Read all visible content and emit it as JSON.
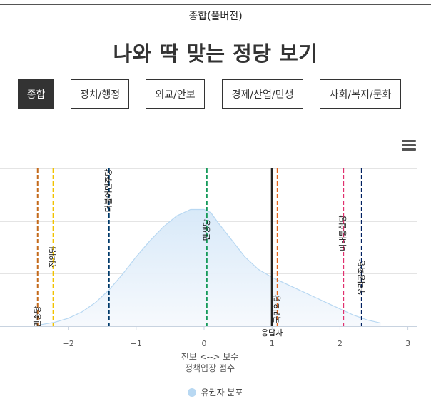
{
  "header": {
    "title": "종합(풀버전)"
  },
  "page": {
    "title": "나와 딱 맞는 정당 보기"
  },
  "tabs": [
    {
      "label": "종합",
      "active": true
    },
    {
      "label": "정치/행정",
      "active": false
    },
    {
      "label": "외교/안보",
      "active": false
    },
    {
      "label": "경제/산업/민생",
      "active": false
    },
    {
      "label": "사회/복지/문화",
      "active": false
    }
  ],
  "menu": {
    "icon": "hamburger-menu-icon"
  },
  "chart_data": {
    "type": "area",
    "xlabel": "진보 <--> 보수",
    "xlabel2": "정책입장 점수",
    "xlim": [
      -2.8,
      3.1
    ],
    "ylim": [
      0,
      1
    ],
    "grid": true,
    "xticks": [
      -2,
      -1,
      0,
      1,
      2,
      3
    ],
    "legend_position": "bottom",
    "series": [
      {
        "name": "유권자 분포",
        "color": "#b8d8f2",
        "x": [
          -2.4,
          -2.2,
          -2.0,
          -1.8,
          -1.6,
          -1.4,
          -1.2,
          -1.0,
          -0.8,
          -0.6,
          -0.4,
          -0.2,
          0.0,
          0.1,
          0.2,
          0.4,
          0.6,
          0.8,
          1.0,
          1.2,
          1.4,
          1.6,
          1.8,
          2.0,
          2.2,
          2.4,
          2.6
        ],
        "y": [
          0.01,
          0.025,
          0.05,
          0.09,
          0.15,
          0.23,
          0.33,
          0.44,
          0.54,
          0.63,
          0.7,
          0.74,
          0.74,
          0.72,
          0.66,
          0.55,
          0.44,
          0.36,
          0.31,
          0.27,
          0.23,
          0.19,
          0.15,
          0.11,
          0.07,
          0.04,
          0.02
        ]
      }
    ],
    "parties": [
      {
        "name": "민중당",
        "x": -2.45,
        "color": "#c46a1b",
        "label_y": 0.06
      },
      {
        "name": "정의당",
        "x": -2.22,
        "color": "#f2c200",
        "label_y": 0.44
      },
      {
        "name": "더불어민주당",
        "x": -1.4,
        "color": "#003a6a",
        "label_y": 0.86
      },
      {
        "name": "민생당",
        "x": 0.04,
        "color": "#159a5a",
        "label_y": 0.61
      },
      {
        "name": "국민의당",
        "x": 1.08,
        "color": "#e3641c",
        "label_y": 0.11
      },
      {
        "name": "미래통합당",
        "x": 2.05,
        "color": "#e0306e",
        "label_y": 0.59
      },
      {
        "name": "우리공화당",
        "x": 2.32,
        "color": "#002060",
        "label_y": 0.31
      }
    ],
    "respondent": {
      "label": "응답자",
      "x": 1.0,
      "color": "#222222"
    }
  }
}
